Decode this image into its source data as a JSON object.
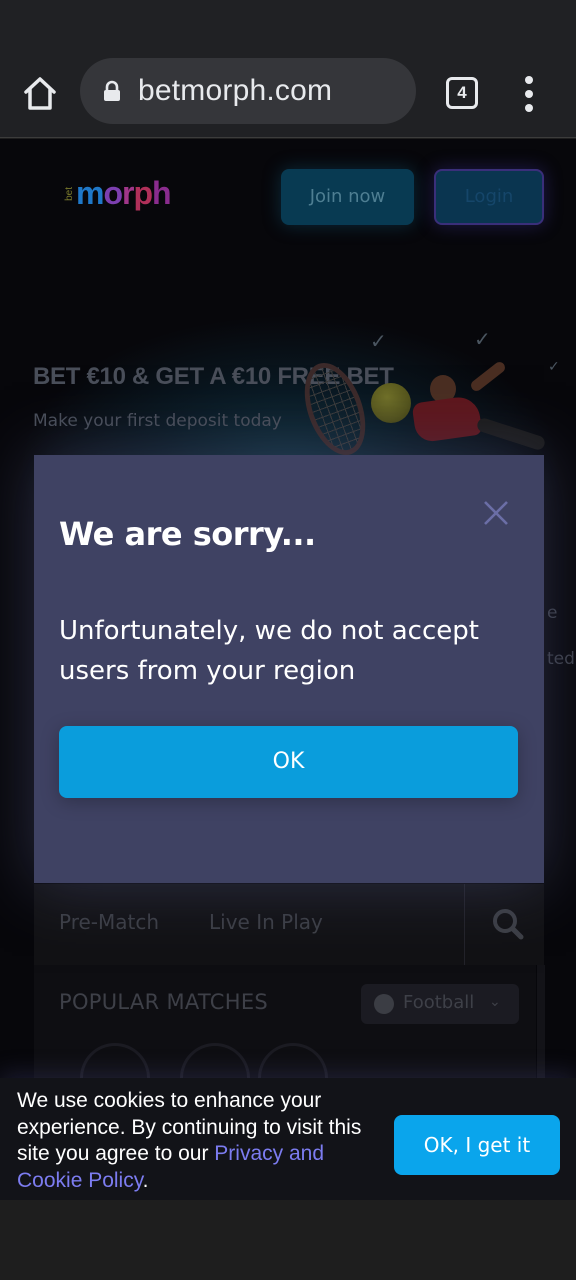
{
  "browser": {
    "url": "betmorph.com",
    "tab_count": "4"
  },
  "site": {
    "logo": {
      "prefix": "bet",
      "name_parts": [
        "m",
        "o",
        "r",
        "p",
        "h"
      ]
    },
    "header": {
      "join_label": "Join now",
      "login_label": "Login"
    },
    "hero": {
      "title": "BET €10 & GET A €10 FREE BET",
      "subtitle": "Make your first deposit today"
    },
    "tabs": [
      {
        "label": "Pre-Match"
      },
      {
        "label": "Live In Play"
      }
    ],
    "popular": {
      "title": "POPULAR MATCHES",
      "sport_selected": "Football"
    },
    "edge_fragments": [
      "e",
      "ted"
    ]
  },
  "modal": {
    "title": "We are sorry...",
    "message": "Unfortunately, we do not accept users from your region",
    "ok_label": "OK"
  },
  "cookie": {
    "text": "We use cookies to enhance your experience. By continuing to visit this site you agree to our ",
    "link_text": "Privacy and Cookie Policy",
    "suffix": ".",
    "button_label": "OK, I get it"
  },
  "colors": {
    "modal_bg": "#3f4263",
    "primary_button": "#0a9ddc",
    "cookie_link": "#7c7cf0",
    "browser_bar": "#202124"
  },
  "icons": [
    "home-icon",
    "lock-icon",
    "more-vert-icon",
    "close-icon",
    "search-icon",
    "soccer-ball-icon",
    "chevron-down-icon"
  ]
}
